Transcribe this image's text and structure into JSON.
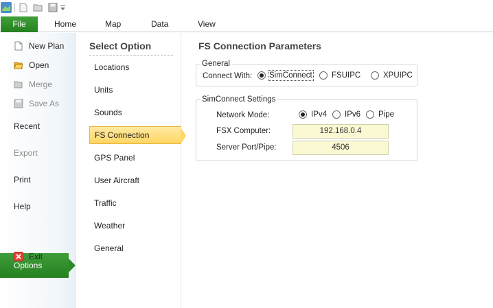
{
  "colors": {
    "accent": "#2f8f29",
    "selected_option": "#ffd663",
    "field_bg": "#fbf8d4"
  },
  "qat": {
    "icons": [
      "app-icon",
      "new-icon",
      "open-icon",
      "save-icon",
      "customize-dropdown-icon"
    ]
  },
  "ribbon": {
    "file_label": "File",
    "tabs": [
      "Home",
      "Map",
      "Data",
      "View"
    ]
  },
  "backstage": {
    "new_plan": "New Plan",
    "open": "Open",
    "merge": "Merge",
    "save_as": "Save As",
    "recent": "Recent",
    "export": "Export",
    "print": "Print",
    "help": "Help",
    "options": "Options",
    "exit": "Exit"
  },
  "options_panel": {
    "title": "Select Option",
    "items": [
      "Locations",
      "Units",
      "Sounds",
      "FS Connection",
      "GPS Panel",
      "User Aircraft",
      "Traffic",
      "Weather",
      "General"
    ],
    "selected": "FS Connection"
  },
  "fs_connection": {
    "title": "FS Connection Parameters",
    "general": {
      "label": "General",
      "connect_with_label": "Connect With:",
      "options": [
        "SimConnect",
        "FSUIPC",
        "XPUIPC"
      ],
      "selected": "SimConnect"
    },
    "simconnect": {
      "label": "SimConnect Settings",
      "network_mode_label": "Network Mode:",
      "network_modes": [
        "IPv4",
        "IPv6",
        "Pipe"
      ],
      "selected_mode": "IPv4",
      "fsx_computer_label": "FSX Computer:",
      "fsx_computer_value": "192.168.0.4",
      "server_port_label": "Server Port/Pipe:",
      "server_port_value": "4506"
    }
  }
}
